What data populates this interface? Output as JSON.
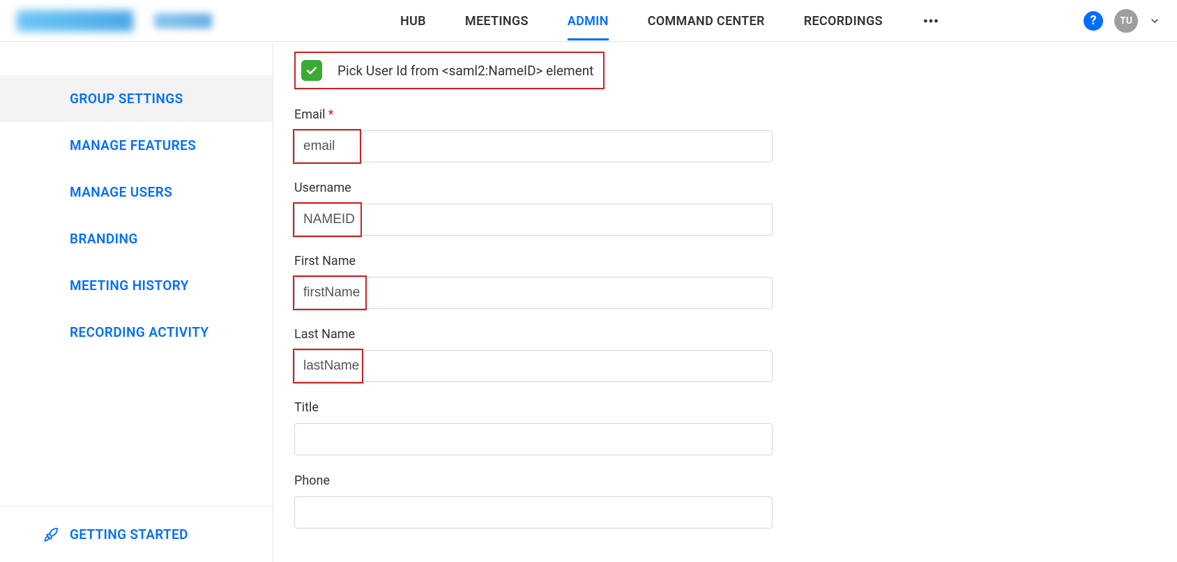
{
  "header": {
    "nav": [
      {
        "label": "HUB",
        "active": false
      },
      {
        "label": "MEETINGS",
        "active": false
      },
      {
        "label": "ADMIN",
        "active": true
      },
      {
        "label": "COMMAND CENTER",
        "active": false
      },
      {
        "label": "RECORDINGS",
        "active": false
      }
    ],
    "avatar_initials": "TU"
  },
  "sidebar": {
    "items": [
      {
        "label": "GROUP SETTINGS",
        "active": true
      },
      {
        "label": "MANAGE FEATURES",
        "active": false
      },
      {
        "label": "MANAGE USERS",
        "active": false
      },
      {
        "label": "BRANDING",
        "active": false
      },
      {
        "label": "MEETING HISTORY",
        "active": false
      },
      {
        "label": "RECORDING ACTIVITY",
        "active": false
      }
    ],
    "getting_started": "GETTING STARTED"
  },
  "form": {
    "checkbox_label": "Pick User Id from <saml2:NameID> element",
    "checkbox_checked": true,
    "fields": [
      {
        "label": "Email",
        "required": true,
        "value": "email",
        "highlight": true
      },
      {
        "label": "Username",
        "required": false,
        "value": "NAMEID",
        "highlight": true
      },
      {
        "label": "First Name",
        "required": false,
        "value": "firstName",
        "highlight": true
      },
      {
        "label": "Last Name",
        "required": false,
        "value": "lastName",
        "highlight": true
      },
      {
        "label": "Title",
        "required": false,
        "value": "",
        "highlight": false
      },
      {
        "label": "Phone",
        "required": false,
        "value": "",
        "highlight": false
      }
    ]
  }
}
